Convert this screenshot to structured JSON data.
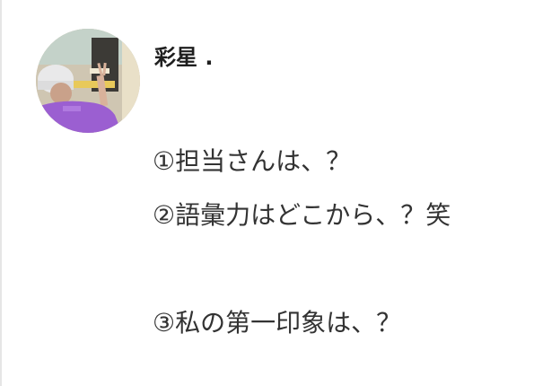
{
  "post": {
    "username": "彩星 .",
    "avatar_icon": "user-photo-avatar",
    "lines": [
      "①担当さんは、？",
      "②語彙力はどこから、？笑",
      "",
      "③私の第一印象は、？"
    ]
  },
  "colors": {
    "background": "#ffffff",
    "text": "#333333",
    "username": "#1f1f1f"
  }
}
